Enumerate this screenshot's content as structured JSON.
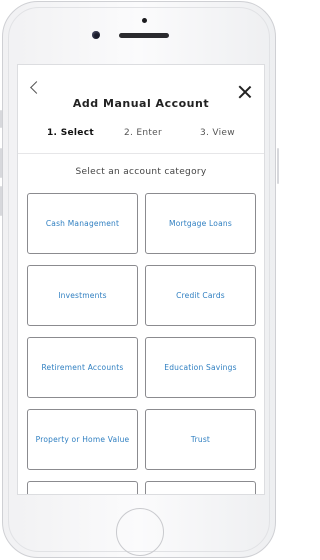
{
  "header": {
    "title": "Add Manual Account"
  },
  "steps": [
    {
      "label": "1. Select",
      "active": true
    },
    {
      "label": "2. Enter",
      "active": false
    },
    {
      "label": "3. View",
      "active": false
    }
  ],
  "subtitle": "Select an account category",
  "categories": [
    {
      "label": "Cash Management"
    },
    {
      "label": "Mortgage Loans"
    },
    {
      "label": "Investments"
    },
    {
      "label": "Credit Cards"
    },
    {
      "label": "Retirement Accounts"
    },
    {
      "label": "Education Savings"
    },
    {
      "label": "Property or Home Value"
    },
    {
      "label": "Trust"
    },
    {
      "label": ""
    },
    {
      "label": ""
    }
  ],
  "icons": {
    "back": "chevron-left-icon",
    "close": "close-icon"
  },
  "colors": {
    "link": "#2f7fc1",
    "border": "#8b8b8f"
  }
}
